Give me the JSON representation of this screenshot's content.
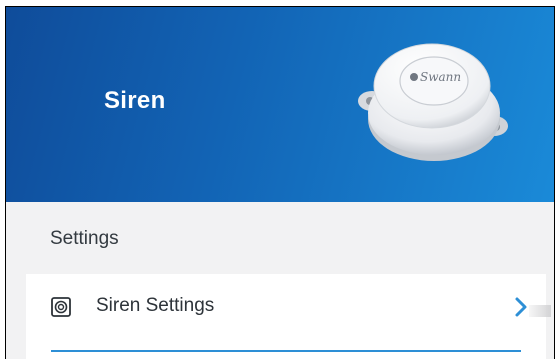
{
  "header": {
    "title": "Siren",
    "device_brand": "Swann",
    "background_color": "#1263b4"
  },
  "section": {
    "title": "Settings"
  },
  "items": [
    {
      "label": "Siren Settings",
      "icon": "siren-settings-icon",
      "trailing_icon": "chevron-right-icon",
      "accent_color": "#2d8fd6"
    }
  ]
}
